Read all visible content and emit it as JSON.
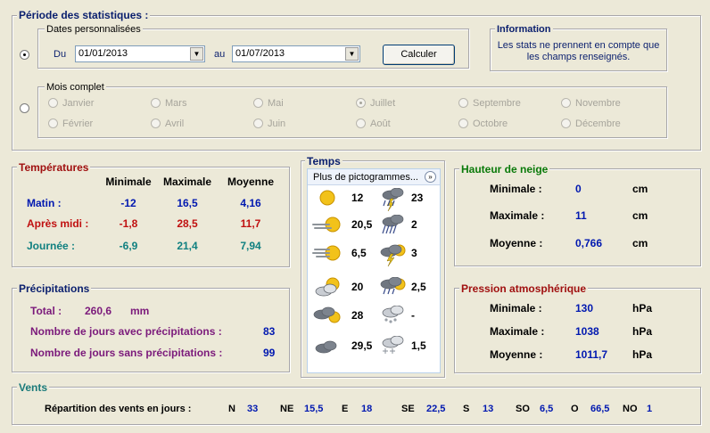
{
  "periode": {
    "title": "Période des statistiques :",
    "dates_perso": {
      "legend": "Dates personnalisées",
      "du_label": "Du",
      "du_value": "01/01/2013",
      "au_label": "au",
      "au_value": "01/07/2013",
      "calc_label": "Calculer"
    },
    "mois_complet": {
      "legend": "Mois complet",
      "months": [
        "Janvier",
        "Février",
        "Mars",
        "Avril",
        "Mai",
        "Juin",
        "Juillet",
        "Août",
        "Septembre",
        "Octobre",
        "Novembre",
        "Décembre"
      ],
      "selected": "Juillet"
    }
  },
  "information": {
    "legend": "Information",
    "text1": "Les stats ne prennent en compte que",
    "text2": "les champs renseignés."
  },
  "temperatures": {
    "legend": "Températures",
    "headers": [
      "Minimale",
      "Maximale",
      "Moyenne"
    ],
    "rows": [
      {
        "label": "Matin :",
        "min": "-12",
        "max": "16,5",
        "moy": "4,16"
      },
      {
        "label": "Après midi :",
        "min": "-1,8",
        "max": "28,5",
        "moy": "11,7"
      },
      {
        "label": "Journée :",
        "min": "-6,9",
        "max": "21,4",
        "moy": "7,94"
      }
    ]
  },
  "temps": {
    "legend": "Temps",
    "dropdown": "Plus de pictogrammes...",
    "left": [
      {
        "icon": "sun-icon",
        "value": "12"
      },
      {
        "icon": "sun-fog-icon",
        "value": "20,5"
      },
      {
        "icon": "sun-haze-icon",
        "value": "6,5"
      },
      {
        "icon": "sun-cloud-icon",
        "value": "20"
      },
      {
        "icon": "cloud-sun-icon",
        "value": "28"
      },
      {
        "icon": "overcast-icon",
        "value": "29,5"
      }
    ],
    "right": [
      {
        "icon": "thunder-rain-icon",
        "value": "23"
      },
      {
        "icon": "heavy-rain-icon",
        "value": "2"
      },
      {
        "icon": "storm-sun-icon",
        "value": "3"
      },
      {
        "icon": "rain-sun-icon",
        "value": "2,5"
      },
      {
        "icon": "hail-icon",
        "value": "-"
      },
      {
        "icon": "snow-icon",
        "value": "1,5"
      }
    ]
  },
  "neige": {
    "legend": "Hauteur de neige",
    "rows": [
      {
        "label": "Minimale :",
        "value": "0",
        "unit": "cm"
      },
      {
        "label": "Maximale :",
        "value": "11",
        "unit": "cm"
      },
      {
        "label": "Moyenne :",
        "value": "0,766",
        "unit": "cm"
      }
    ]
  },
  "precipitations": {
    "legend": "Précipitations",
    "total_label": "Total :",
    "total_value": "260,6",
    "total_unit": "mm",
    "avec_label": "Nombre de jours avec précipitations :",
    "avec_value": "83",
    "sans_label": "Nombre de jours sans précipitations :",
    "sans_value": "99"
  },
  "pression": {
    "legend": "Pression atmosphérique",
    "rows": [
      {
        "label": "Minimale :",
        "value": "130",
        "unit": "hPa"
      },
      {
        "label": "Maximale :",
        "value": "1038",
        "unit": "hPa"
      },
      {
        "label": "Moyenne :",
        "value": "1011,7",
        "unit": "hPa"
      }
    ]
  },
  "vents": {
    "legend": "Vents",
    "label": "Répartition des vents en jours :",
    "dirs": [
      {
        "dir": "N",
        "value": "33"
      },
      {
        "dir": "NE",
        "value": "15,5"
      },
      {
        "dir": "E",
        "value": "18"
      },
      {
        "dir": "SE",
        "value": "22,5"
      },
      {
        "dir": "S",
        "value": "13"
      },
      {
        "dir": "SO",
        "value": "6,5"
      },
      {
        "dir": "O",
        "value": "66,5"
      },
      {
        "dir": "NO",
        "value": "1"
      }
    ]
  }
}
